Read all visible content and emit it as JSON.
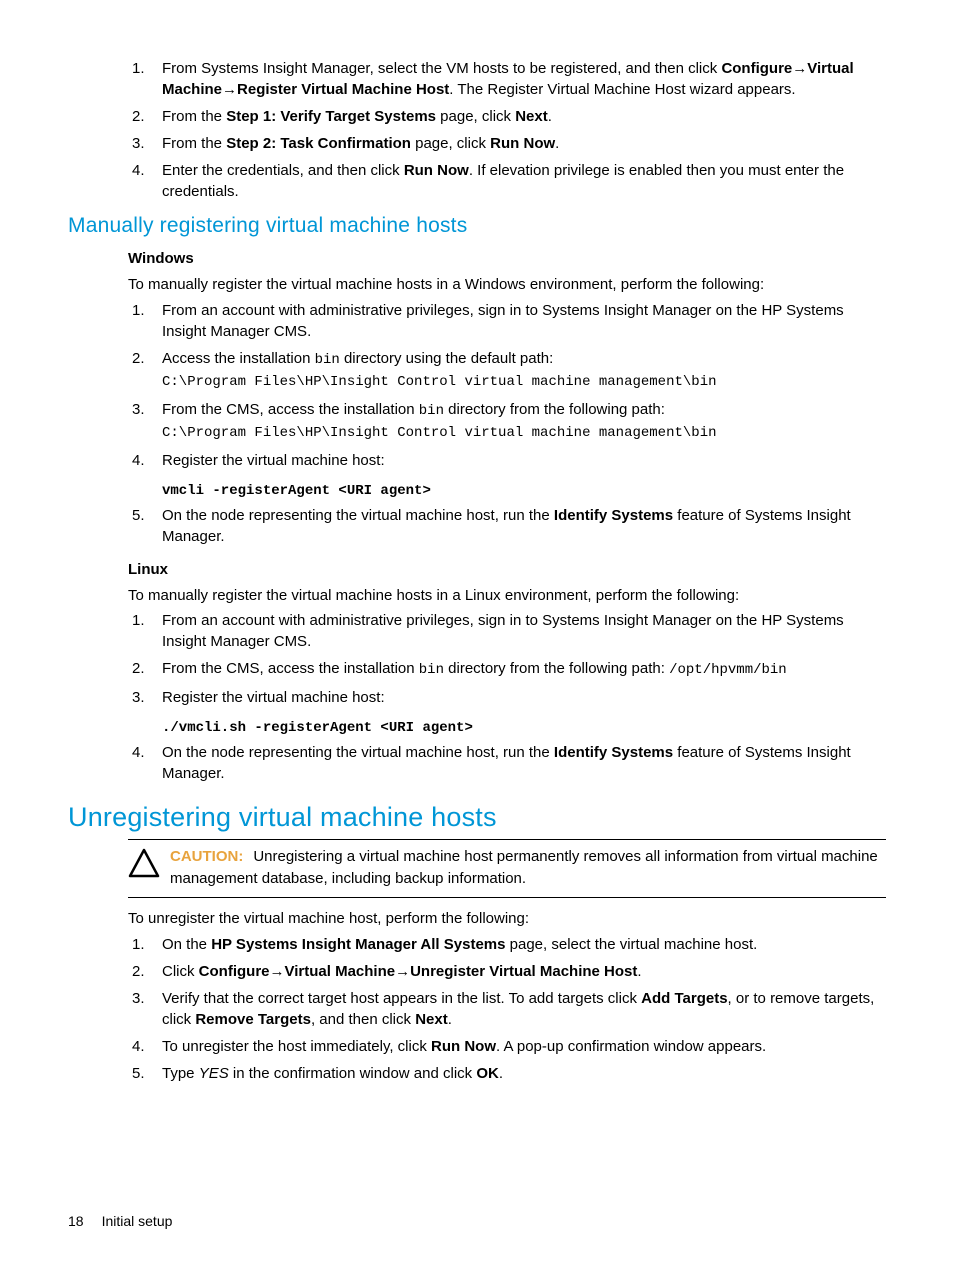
{
  "section1": {
    "items": [
      {
        "pre": "From Systems Insight Manager, select the VM hosts to be registered, and then click ",
        "b1": "Configure",
        "arrow1": "→",
        "b2": "Virtual Machine",
        "arrow2": "→",
        "b3": "Register Virtual Machine Host",
        "post": ". The Register Virtual Machine Host wizard appears."
      },
      {
        "pre": "From the ",
        "b1": "Step 1: Verify Target Systems",
        "mid": " page, click ",
        "b2": "Next",
        "post": "."
      },
      {
        "pre": "From the ",
        "b1": "Step 2: Task Confirmation",
        "mid": " page, click ",
        "b2": "Run Now",
        "post": "."
      },
      {
        "pre": "Enter the credentials, and then click ",
        "b1": "Run Now",
        "post": ". If elevation privilege is enabled then you must enter the credentials."
      }
    ]
  },
  "h_manual": "Manually registering virtual machine hosts",
  "windows": {
    "label": "Windows",
    "intro": "To manually register the virtual machine hosts in a Windows environment, perform the following:",
    "items": [
      {
        "text": "From an account with administrative privileges, sign in to Systems Insight Manager on the HP Systems Insight Manager CMS."
      },
      {
        "pre": "Access the installation ",
        "code_inline": "bin",
        "mid": " directory using the default path:",
        "code_line": "C:\\Program Files\\HP\\Insight Control virtual machine management\\bin"
      },
      {
        "pre": "From the CMS, access the installation ",
        "code_inline": "bin",
        "mid": " directory from the following path:",
        "code_line": "C:\\Program Files\\HP\\Insight Control virtual machine management\\bin"
      },
      {
        "text": "Register the virtual machine host:",
        "code_line": "vmcli -registerAgent <URI agent>"
      },
      {
        "pre": "On the node representing the virtual machine host, run the ",
        "b1": "Identify Systems",
        "post": " feature of Systems Insight Manager."
      }
    ]
  },
  "linux": {
    "label": "Linux",
    "intro": "To manually register the virtual machine hosts in a Linux environment, perform the following:",
    "items": [
      {
        "text": "From an account with administrative privileges, sign in to Systems Insight Manager on the HP Systems Insight Manager CMS."
      },
      {
        "pre": "From the CMS, access the installation ",
        "code_inline": "bin",
        "mid": " directory from the following path: ",
        "code_line_inline": "/opt/hpvmm/bin"
      },
      {
        "text": "Register the virtual machine host:",
        "code_line": "./vmcli.sh -registerAgent <URI agent>"
      },
      {
        "pre": "On the node representing the virtual machine host, run the ",
        "b1": "Identify Systems",
        "post": " feature of Systems Insight Manager."
      }
    ]
  },
  "h_unreg": "Unregistering virtual machine hosts",
  "caution": {
    "label": "CAUTION:",
    "text": "Unregistering a virtual machine host permanently removes all information from virtual machine management database, including backup information."
  },
  "unreg": {
    "intro": "To unregister the virtual machine host, perform the following:",
    "items": [
      {
        "pre": "On the ",
        "b1": "HP Systems Insight Manager All Systems",
        "post": " page, select the virtual machine host."
      },
      {
        "pre": "Click ",
        "b1": "Configure",
        "arrow1": "→",
        "b2": "Virtual Machine",
        "arrow2": "→",
        "b3": "Unregister Virtual Machine Host",
        "post": "."
      },
      {
        "pre": "Verify that the correct target host appears in the list. To add targets click ",
        "b1": "Add Targets",
        "mid": ", or to remove targets, click ",
        "b2": "Remove Targets",
        "mid2": ", and then click ",
        "b3": "Next",
        "post": "."
      },
      {
        "pre": "To unregister the host immediately, click ",
        "b1": "Run Now",
        "post": ". A pop-up confirmation window appears."
      },
      {
        "pre": "Type ",
        "ital": "YES",
        "mid": " in the confirmation window and click ",
        "b1": "OK",
        "post": "."
      }
    ]
  },
  "footer": {
    "page": "18",
    "section": "Initial setup"
  }
}
